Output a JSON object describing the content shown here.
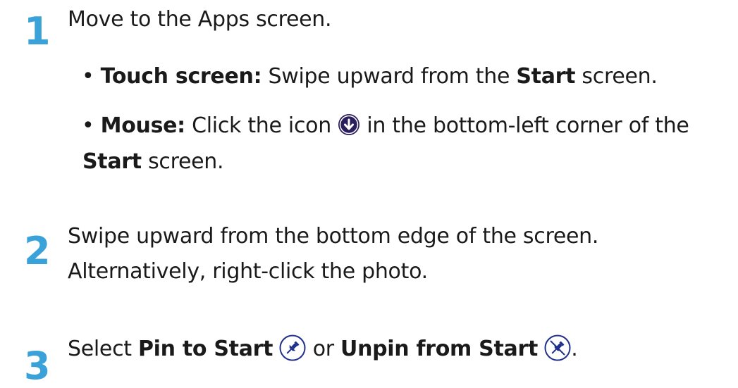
{
  "steps": [
    {
      "number": "1",
      "text": "Move to the Apps screen.",
      "bullets": [
        {
          "bullet": "•",
          "label": "Touch screen:",
          "text_a": " Swipe upward from the ",
          "bold_a": "Start",
          "text_b": " screen."
        },
        {
          "bullet": "•",
          "label": "Mouse:",
          "text_a": " Click the icon ",
          "icon": "down-arrow-circle-icon",
          "text_b": " in the bottom-left corner of the",
          "cont_bold": "Start",
          "cont_text": " screen."
        }
      ]
    },
    {
      "number": "2",
      "line1": "Swipe upward from the bottom edge of the screen.",
      "line2": "Alternatively, right-click the photo."
    },
    {
      "number": "3",
      "text_a": "Select ",
      "bold_a": "Pin to Start",
      "icon_a": "pin-icon",
      "text_b": " or ",
      "bold_b": "Unpin from Start",
      "icon_b": "unpin-icon",
      "text_c": "."
    }
  ],
  "colors": {
    "step_number": "#3aa2d9",
    "icon_fill": "#2a1f5c",
    "pin_icon": "#1f2f8c"
  }
}
